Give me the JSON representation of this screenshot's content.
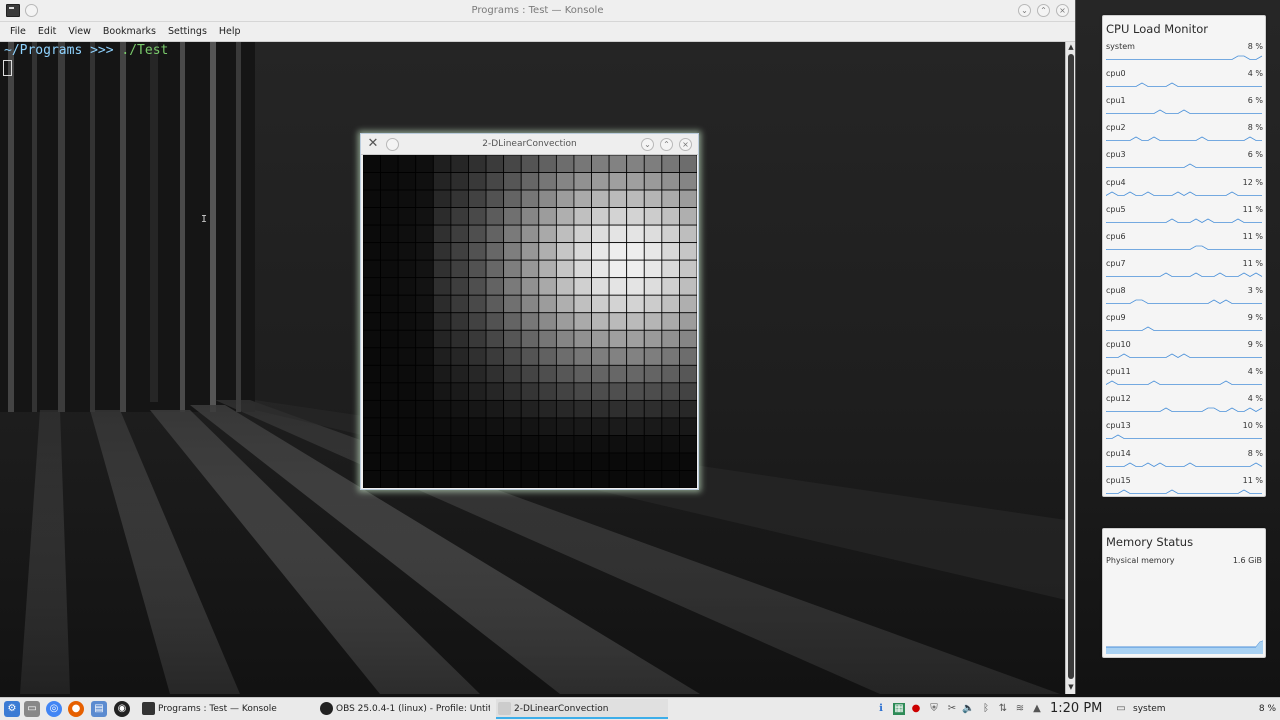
{
  "konsole": {
    "title": "Programs : Test — Konsole",
    "menu": [
      "File",
      "Edit",
      "View",
      "Bookmarks",
      "Settings",
      "Help"
    ],
    "prompt_path": "~/Programs >>> ",
    "prompt_cmd": "./Test"
  },
  "conv_window": {
    "title": "2-DLinearConvection",
    "close_glyph": "×",
    "grid": {
      "cols": 19,
      "rows": 19
    }
  },
  "cpu_monitor": {
    "title": "CPU Load Monitor",
    "rows": [
      {
        "label": "system",
        "value": "8 %"
      },
      {
        "label": "cpu0",
        "value": "4 %"
      },
      {
        "label": "cpu1",
        "value": "6 %"
      },
      {
        "label": "cpu2",
        "value": "8 %"
      },
      {
        "label": "cpu3",
        "value": "6 %"
      },
      {
        "label": "cpu4",
        "value": "12 %"
      },
      {
        "label": "cpu5",
        "value": "11 %"
      },
      {
        "label": "cpu6",
        "value": "11 %"
      },
      {
        "label": "cpu7",
        "value": "11 %"
      },
      {
        "label": "cpu8",
        "value": "3 %"
      },
      {
        "label": "cpu9",
        "value": "9 %"
      },
      {
        "label": "cpu10",
        "value": "9 %"
      },
      {
        "label": "cpu11",
        "value": "4 %"
      },
      {
        "label": "cpu12",
        "value": "4 %"
      },
      {
        "label": "cpu13",
        "value": "10 %"
      },
      {
        "label": "cpu14",
        "value": "8 %"
      },
      {
        "label": "cpu15",
        "value": "11 %"
      }
    ]
  },
  "memory": {
    "title": "Memory Status",
    "label": "Physical memory",
    "value": "1.6 GiB"
  },
  "taskbar": {
    "tasks": [
      {
        "label": "Programs : Test — Konsole"
      },
      {
        "label": "OBS 25.0.4-1 (linux) - Profile: Untitl..."
      },
      {
        "label": "2-DLinearConvection"
      }
    ],
    "clock": "1:20 PM",
    "sysmon_label": "system",
    "sysmon_value": "8 %"
  },
  "colors": {
    "accent": "#3daee9",
    "graph_line": "#4a90d9"
  }
}
